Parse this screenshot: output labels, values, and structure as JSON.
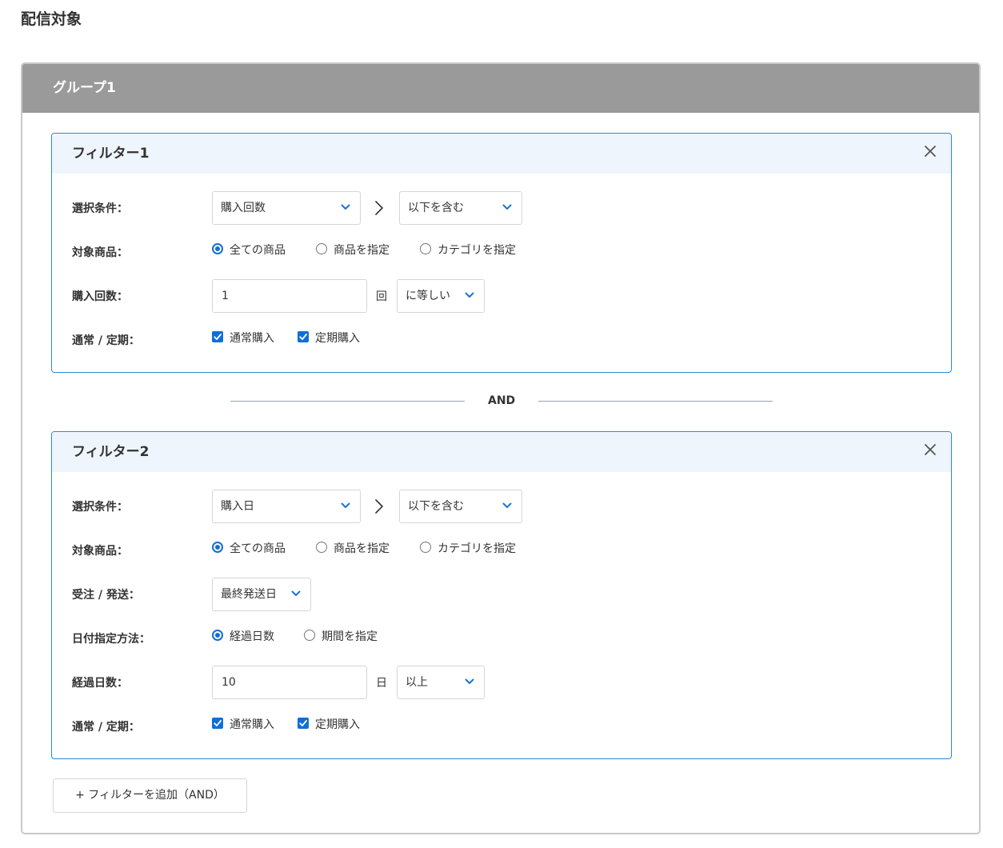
{
  "page": {
    "title": "配信対象"
  },
  "group": {
    "title": "グループ1",
    "separator_label": "AND",
    "add_filter_label": "+ フィルターを追加（AND）"
  },
  "filter1": {
    "title": "フィルター1",
    "condition_label": "選択条件：",
    "condition_value": "購入回数",
    "condition_op": "以下を含む",
    "target_label": "対象商品：",
    "target_options": [
      "全ての商品",
      "商品を指定",
      "カテゴリを指定"
    ],
    "target_selected": "全ての商品",
    "count_label": "購入回数：",
    "count_value": "1",
    "count_unit": "回",
    "count_op": "に等しい",
    "type_label": "通常 / 定期：",
    "type_options": [
      "通常購入",
      "定期購入"
    ]
  },
  "filter2": {
    "title": "フィルター2",
    "condition_label": "選択条件：",
    "condition_value": "購入日",
    "condition_op": "以下を含む",
    "target_label": "対象商品：",
    "target_options": [
      "全ての商品",
      "商品を指定",
      "カテゴリを指定"
    ],
    "target_selected": "全ての商品",
    "order_label": "受注 / 発送：",
    "order_value": "最終発送日",
    "date_method_label": "日付指定方法：",
    "date_method_options": [
      "経過日数",
      "期間を指定"
    ],
    "date_method_selected": "経過日数",
    "elapsed_label": "経過日数：",
    "elapsed_value": "10",
    "elapsed_unit": "日",
    "elapsed_op": "以上",
    "type_label": "通常 / 定期：",
    "type_options": [
      "通常購入",
      "定期購入"
    ]
  },
  "colors": {
    "accent": "#0f6fd6",
    "filter_border": "#2d8ad2",
    "group_header": "#9a9a9a",
    "filter_header_bg": "#eff5fd"
  },
  "icons": {
    "close": "close-icon",
    "chevron": "chevron-down-icon",
    "arrow": "chevron-right-icon",
    "check": "checkmark-icon"
  }
}
